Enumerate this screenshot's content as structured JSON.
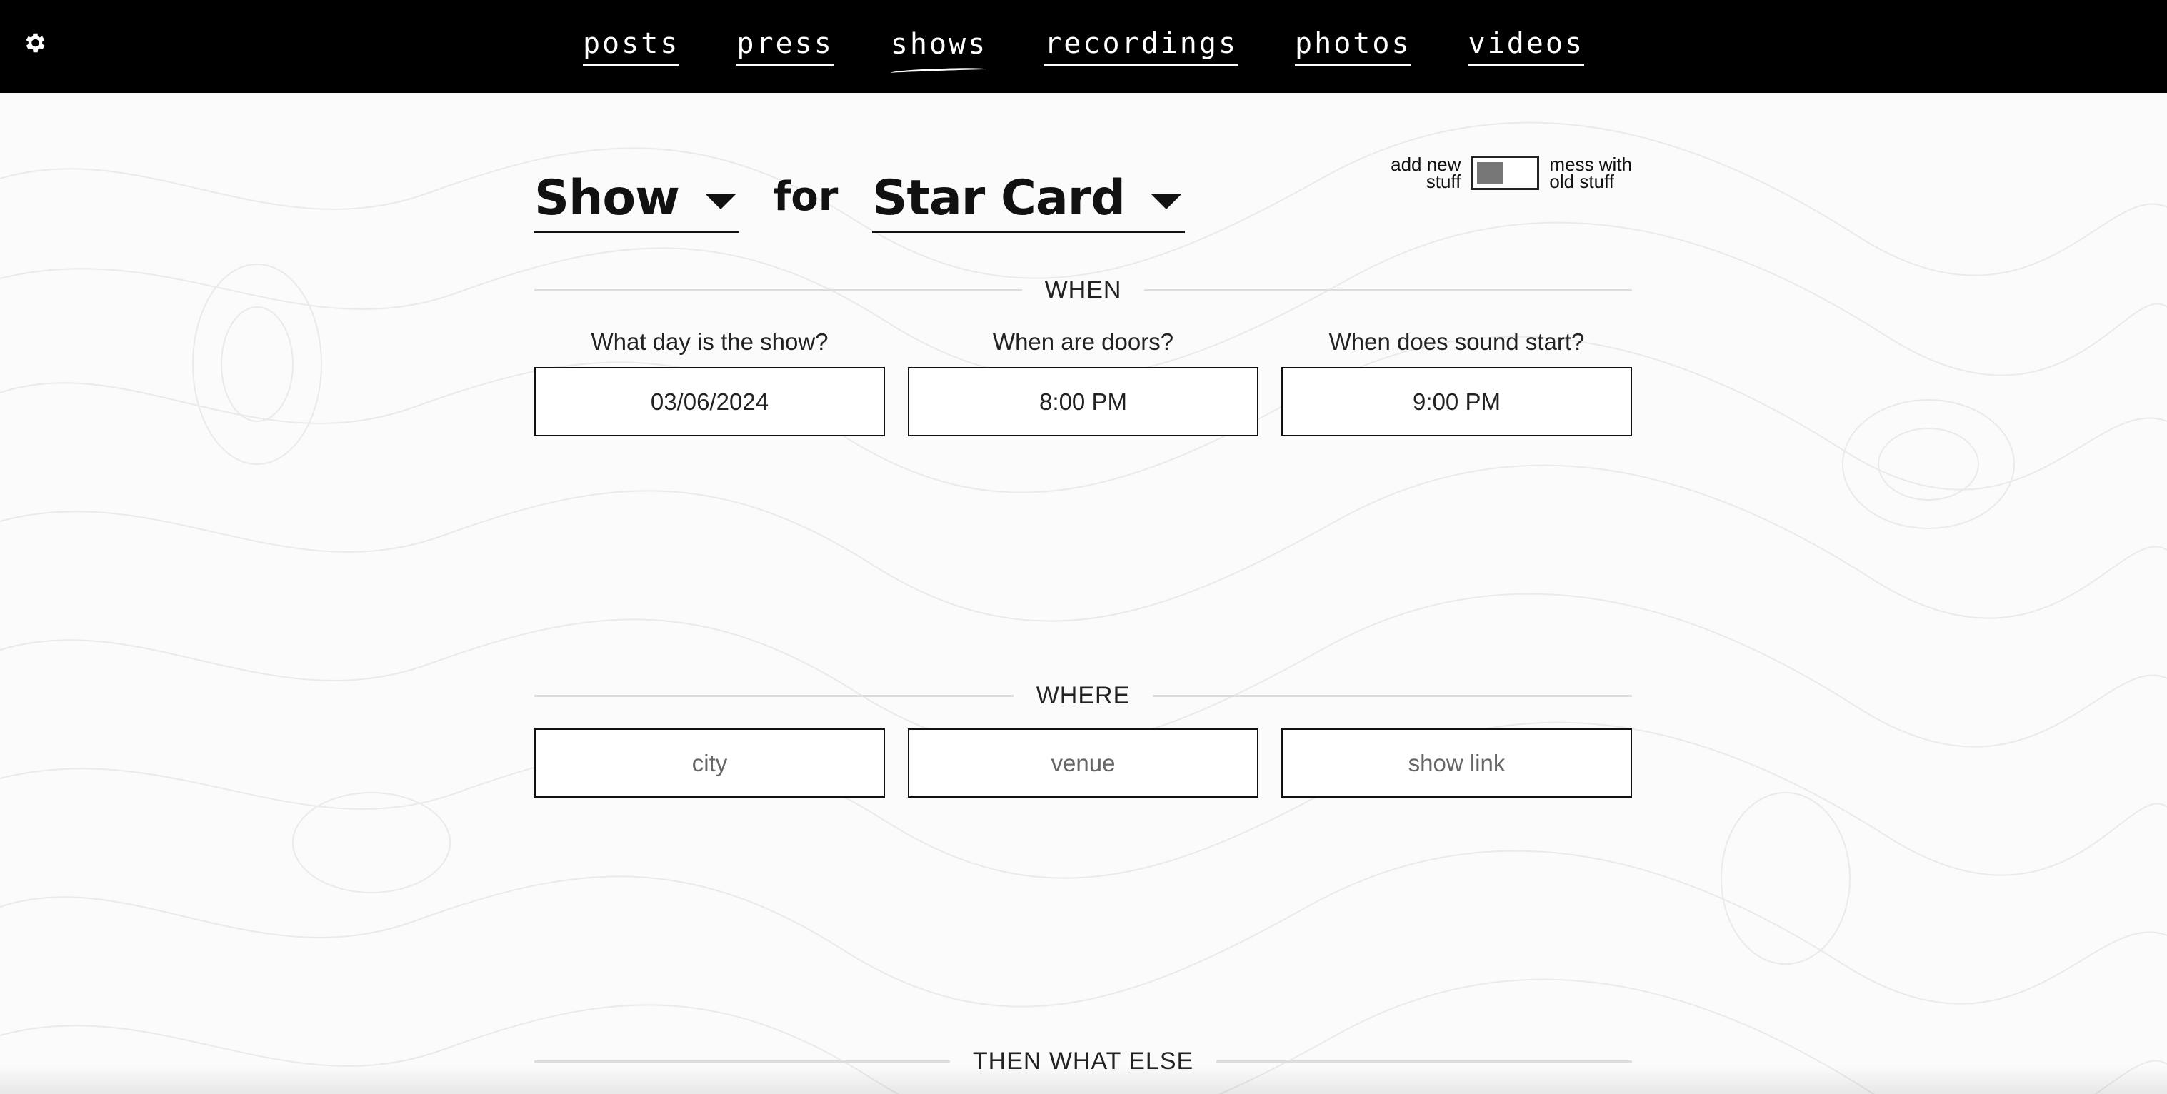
{
  "nav": {
    "items": [
      {
        "label": "posts",
        "active": false
      },
      {
        "label": "press",
        "active": false
      },
      {
        "label": "shows",
        "active": true
      },
      {
        "label": "recordings",
        "active": false
      },
      {
        "label": "photos",
        "active": false
      },
      {
        "label": "videos",
        "active": false
      }
    ],
    "settings_icon": "gear-icon"
  },
  "heading": {
    "type_value": "Show",
    "for_word": "for",
    "artist_value": "Star Card"
  },
  "toggle": {
    "left_label_1": "add new",
    "left_label_2": "stuff",
    "right_label_1": "mess with",
    "right_label_2": "old stuff"
  },
  "when": {
    "section_title": "WHEN",
    "date_label": "What day is the show?",
    "date_value": "03/06/2024",
    "doors_label": "When are doors?",
    "doors_value": "8:00 PM",
    "sound_label": "When does sound start?",
    "sound_value": "9:00 PM"
  },
  "where": {
    "section_title": "WHERE",
    "city_placeholder": "city",
    "venue_placeholder": "venue",
    "link_placeholder": "show link"
  },
  "then": {
    "section_title": "THEN WHAT ELSE"
  },
  "colors": {
    "nav_bg": "#000000",
    "page_bg": "#fbfbfb",
    "text": "#111111"
  }
}
